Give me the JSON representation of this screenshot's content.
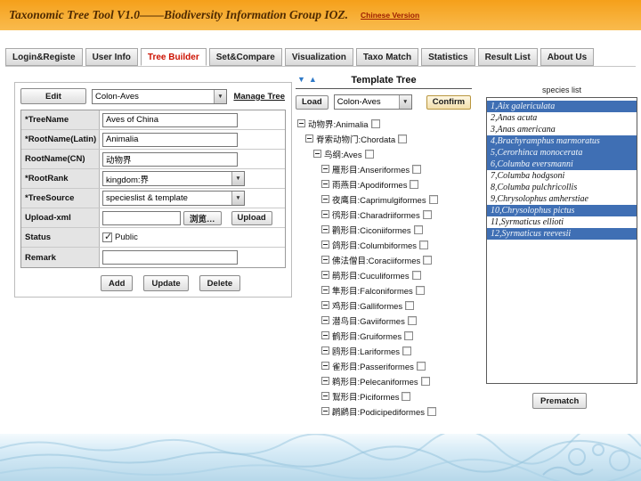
{
  "header": {
    "title": "Taxonomic Tree Tool V1.0——Biodiversity Information Group IOZ.",
    "chinese_version": "Chinese Version"
  },
  "tabs": [
    "Login&Registe",
    "User Info",
    "Tree Builder",
    "Set&Compare",
    "Visualization",
    "Taxo Match",
    "Statistics",
    "Result List",
    "About Us"
  ],
  "active_tab": "Tree Builder",
  "tree_form": {
    "edit_button": "Edit",
    "tree_select_value": "Colon-Aves",
    "manage_tree_link": "Manage Tree",
    "fields": {
      "tree_name": {
        "label": "*TreeName",
        "value": "Aves of China"
      },
      "root_name_latin": {
        "label": "*RootName(Latin)",
        "value": "Animalia"
      },
      "root_name_cn": {
        "label": "RootName(CN)",
        "value": "动物界"
      },
      "root_rank": {
        "label": "*RootRank",
        "value": "kingdom:界"
      },
      "tree_source": {
        "label": "*TreeSource",
        "value": "specieslist & template"
      },
      "upload_xml": {
        "label": "Upload-xml",
        "value": "",
        "browse_button": "浏览…",
        "upload_button": "Upload"
      },
      "status": {
        "label": "Status",
        "checkbox_label": "Public",
        "checked": true
      },
      "remark": {
        "label": "Remark",
        "value": ""
      }
    },
    "buttons": {
      "add": "Add",
      "update": "Update",
      "delete": "Delete"
    }
  },
  "template_tree": {
    "title": "Template Tree",
    "load_button": "Load",
    "select_value": "Colon-Aves",
    "confirm_button": "Confirm",
    "nodes": [
      {
        "label": "动物界:Animalia",
        "level": 0
      },
      {
        "label": "脊索动物门:Chordata",
        "level": 1
      },
      {
        "label": "鸟纲:Aves",
        "level": 2
      },
      {
        "label": "雁形目:Anseriformes",
        "level": 3
      },
      {
        "label": "雨燕目:Apodiformes",
        "level": 3
      },
      {
        "label": "夜鹰目:Caprimulgiformes",
        "level": 3
      },
      {
        "label": "鸻形目:Charadriiformes",
        "level": 3
      },
      {
        "label": "鹳形目:Ciconiiformes",
        "level": 3
      },
      {
        "label": "鸽形目:Columbiformes",
        "level": 3
      },
      {
        "label": "佛法僧目:Coraciiformes",
        "level": 3
      },
      {
        "label": "鹃形目:Cuculiformes",
        "level": 3
      },
      {
        "label": "隼形目:Falconiformes",
        "level": 3
      },
      {
        "label": "鸡形目:Galliformes",
        "level": 3
      },
      {
        "label": "潜鸟目:Gaviiformes",
        "level": 3
      },
      {
        "label": "鹤形目:Gruiformes",
        "level": 3
      },
      {
        "label": "鸥形目:Lariformes",
        "level": 3
      },
      {
        "label": "雀形目:Passeriformes",
        "level": 3
      },
      {
        "label": "鹈形目:Pelecaniformes",
        "level": 3
      },
      {
        "label": "鴷形目:Piciformes",
        "level": 3
      },
      {
        "label": "䴙䴘目:Podicipediformes",
        "level": 3
      }
    ]
  },
  "species_panel": {
    "title": "species list",
    "items": [
      {
        "text": "1,Aix galericulata",
        "highlighted": true
      },
      {
        "text": "2,Anas acuta",
        "highlighted": false
      },
      {
        "text": "3,Anas americana",
        "highlighted": false
      },
      {
        "text": "4,Brachyramphus marmoratus",
        "highlighted": true
      },
      {
        "text": "5,Cerorhinca monocerata",
        "highlighted": true
      },
      {
        "text": "6,Columba eversmanni",
        "highlighted": true
      },
      {
        "text": "7,Columba hodgsoni",
        "highlighted": false
      },
      {
        "text": "8,Columba pulchricollis",
        "highlighted": false
      },
      {
        "text": "9,Chrysolophus amherstiae",
        "highlighted": false
      },
      {
        "text": "10,Chrysolophus pictus",
        "highlighted": true
      },
      {
        "text": "11,Syrmaticus ellioti",
        "highlighted": false
      },
      {
        "text": "12,Syrmaticus reevesii",
        "highlighted": true
      }
    ],
    "prematch_button": "Prematch"
  }
}
